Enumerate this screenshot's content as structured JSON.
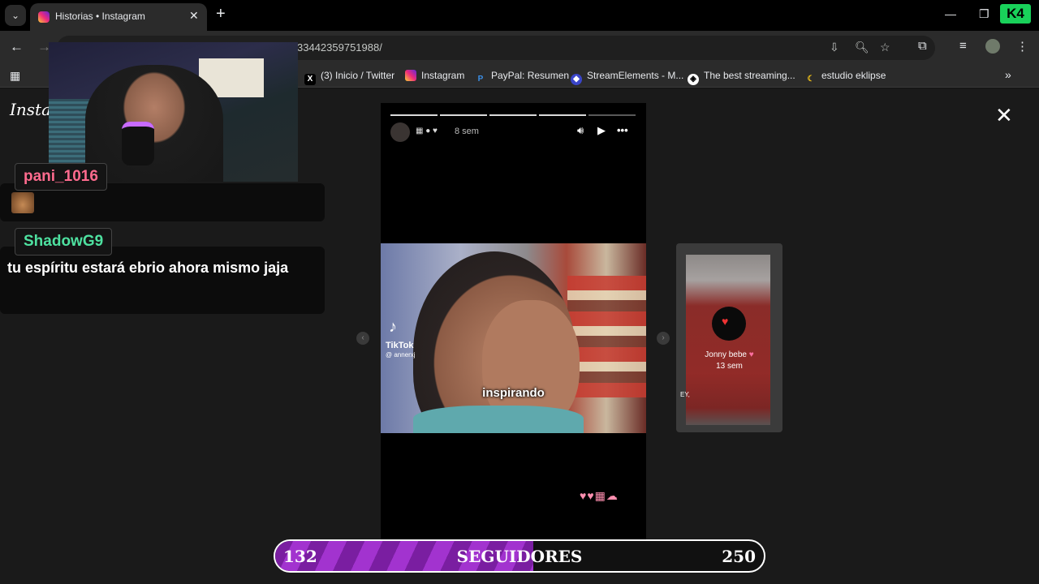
{
  "browser": {
    "tab_title": "Historias • Instagram",
    "url_fragment": "33442359751988/"
  },
  "bookmarks": [
    {
      "label": "(3) Inicio / Twitter",
      "icon": "x-twitter-icon"
    },
    {
      "label": "Instagram",
      "icon": "instagram-icon"
    },
    {
      "label": "PayPal: Resumen",
      "icon": "paypal-icon"
    },
    {
      "label": "StreamElements - M...",
      "icon": "streamelements-icon"
    },
    {
      "label": "The best streaming...",
      "icon": "streaming-icon"
    },
    {
      "label": "estudio eklipse",
      "icon": "eklipse-icon"
    }
  ],
  "page": {
    "logo_text": "Instag"
  },
  "story": {
    "time": "8 sem",
    "caption": "inspirando",
    "tiktok_label": "TikTok",
    "tiktok_handle": "@ annerxj",
    "progress_segments": 5
  },
  "next_story": {
    "user": "Jonny bebe",
    "time": "13 sem",
    "overlay_text": "EY,"
  },
  "chat": [
    {
      "user": "pani_1016",
      "color": "#ff6b6b",
      "message": ""
    },
    {
      "user": "ShadowG9",
      "color": "#4ee1a0",
      "message": "tu espíritu estará ebrio ahora mismo jaja"
    }
  ],
  "followers_goal": {
    "current": "132",
    "label": "SEGUIDORES",
    "target": "250",
    "progress_fraction": 0.528
  },
  "colors": {
    "accent_green": "#19d15a",
    "bar_purple": "#a233cf"
  }
}
